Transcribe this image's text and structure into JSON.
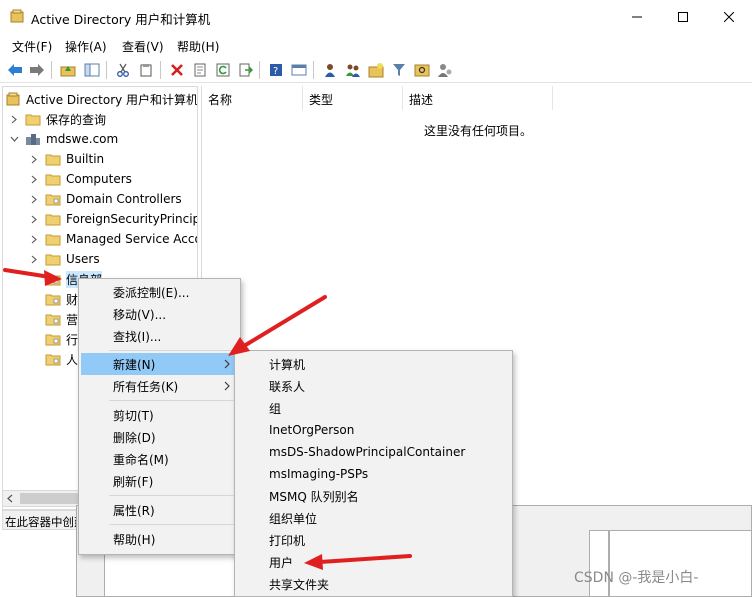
{
  "window": {
    "title": "Active Directory 用户和计算机",
    "minimize_icon": "minimize-icon",
    "maximize_icon": "maximize-icon",
    "close_icon": "close-icon"
  },
  "menubar": [
    "文件(F)",
    "操作(A)",
    "查看(V)",
    "帮助(H)"
  ],
  "toolbar_icons": [
    "back-icon",
    "forward-icon",
    "up-folder-icon",
    "show-hide-tree-icon",
    "cut-icon",
    "paste-icon",
    "delete-icon",
    "properties-icon",
    "refresh-icon",
    "export-icon",
    "help-icon",
    "console-icon",
    "new-user-icon",
    "new-group-icon",
    "new-ou-icon",
    "filter-icon",
    "find-icon",
    "delegate-icon"
  ],
  "tree": {
    "root": "Active Directory 用户和计算机",
    "saved_queries": "保存的查询",
    "domain": "mdswe.com",
    "children": [
      "Builtin",
      "Computers",
      "Domain Controllers",
      "ForeignSecurityPrincipals",
      "Managed Service Accounts",
      "Users",
      "信息部",
      "财",
      "营",
      "行",
      "人"
    ],
    "selected": "信息部"
  },
  "status_text": "在此容器中创建",
  "list": {
    "columns": [
      "名称",
      "类型",
      "描述"
    ],
    "empty_message": "这里没有任何项目。"
  },
  "context_menu": {
    "items": [
      "委派控制(E)...",
      "移动(V)...",
      "查找(I)...",
      "新建(N)",
      "所有任务(K)",
      "剪切(T)",
      "删除(D)",
      "重命名(M)",
      "刷新(F)",
      "属性(R)",
      "帮助(H)"
    ],
    "highlighted": "新建(N)"
  },
  "submenu": {
    "items": [
      "计算机",
      "联系人",
      "组",
      "InetOrgPerson",
      "msDS-ShadowPrincipalContainer",
      "msImaging-PSPs",
      "MSMQ 队列别名",
      "组织单位",
      "打印机",
      "用户",
      "共享文件夹"
    ]
  },
  "annotations": [
    "red-arrow-icon"
  ],
  "watermark": "CSDN @-我是小白-",
  "colors": {
    "highlight": "#91c9f7",
    "selection": "#cce8ff",
    "folder": "#e8c25a",
    "arrow": "#e02020"
  }
}
